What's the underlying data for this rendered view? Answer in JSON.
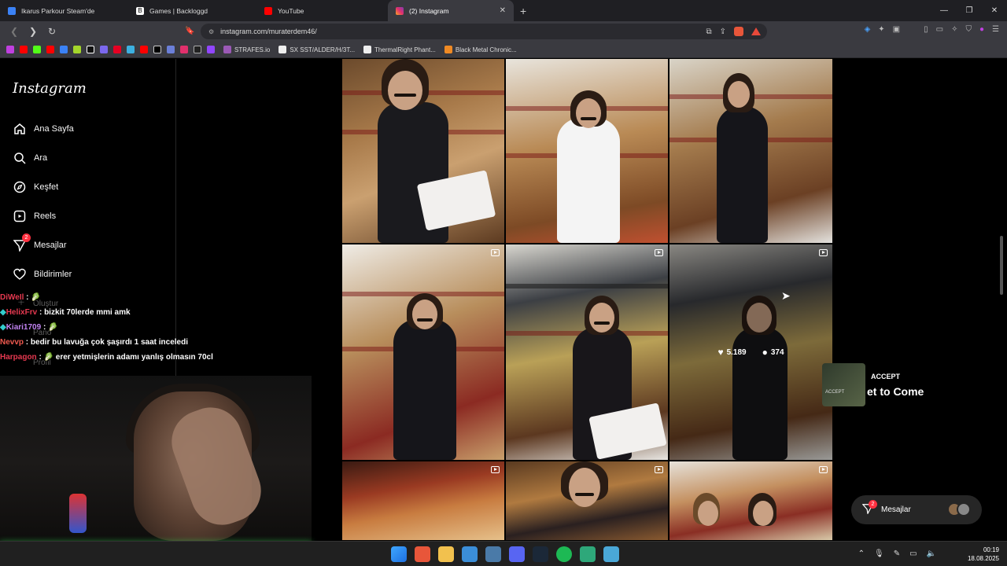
{
  "browser": {
    "tabs": [
      {
        "title": "Ikarus Parkour Steam'de",
        "color": "#3b82f6"
      },
      {
        "title": "Games | Backloggd",
        "color": "#ffffff"
      },
      {
        "title": "YouTube",
        "color": "#ff0000"
      },
      {
        "title": "(2) Instagram",
        "color": "#e1306c",
        "active": true
      }
    ],
    "new_tab": "+",
    "url": "instagram.com/muraterdem46/",
    "window_controls": [
      "—",
      "❐",
      "✕"
    ]
  },
  "bookmarks": [
    {
      "label": "STRAFES.io",
      "color": "#9b59b6"
    },
    {
      "label": "SX SST/ALDER/H/3T...",
      "color": "#eeeeee"
    },
    {
      "label": "ThermalRight Phant...",
      "color": "#eeeeee"
    },
    {
      "label": "Black Metal Chronic...",
      "color": "#f08a24"
    }
  ],
  "sidebar": {
    "logo": "Instagram",
    "items": [
      {
        "label": "Ana Sayfa",
        "icon": "home-icon"
      },
      {
        "label": "Ara",
        "icon": "search-icon"
      },
      {
        "label": "Keşfet",
        "icon": "compass-icon"
      },
      {
        "label": "Reels",
        "icon": "reels-icon"
      },
      {
        "label": "Mesajlar",
        "icon": "messenger-icon",
        "badge": "2"
      },
      {
        "label": "Bildirimler",
        "icon": "heart-icon"
      },
      {
        "label": "Oluştur",
        "icon": "plus-icon"
      },
      {
        "label": "Pano",
        "icon": "dashboard-icon"
      },
      {
        "label": "Profil",
        "icon": "profile-icon"
      }
    ]
  },
  "chat": [
    {
      "user": "DiWeIl",
      "sep": " : ",
      "msg": "🥬"
    },
    {
      "user": "HelixFrv",
      "sep": " : ",
      "msg": "bizkit 70lerde mmi amk"
    },
    {
      "user": "Kiari1709",
      "sep": " : ",
      "msg": "🥬"
    },
    {
      "user": "Nevvp",
      "sep": " : ",
      "msg": "bedir bu lavuğa çok şaşırdı 1 saat inceledi"
    },
    {
      "user": "Harpagon",
      "sep": " : ",
      "msg": "🥬 erer yetmişlerin adamı yanlış olmasın 70cl"
    }
  ],
  "grid_post_stats": {
    "likes": "5.189",
    "comments": "374"
  },
  "accept_overlay": {
    "label": "ACCEPT",
    "title": "et to Come",
    "small": "ACCEPT"
  },
  "messages_pill": {
    "label": "Mesajlar",
    "badge": "2"
  },
  "clock": {
    "time": "00:19",
    "date": "18.08.2025"
  }
}
